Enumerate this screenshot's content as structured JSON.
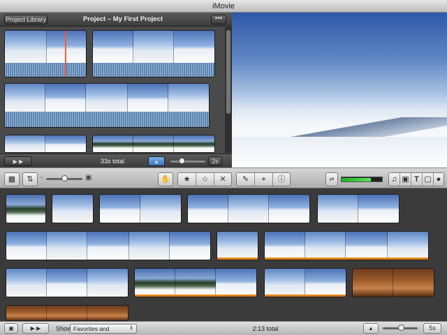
{
  "window": {
    "title": "iMovie"
  },
  "project": {
    "back_button": "Project Library",
    "title": "Project – My First Project",
    "total": "33s total",
    "zoom_value": "2s"
  },
  "toolbar": {
    "icons": [
      "camera-import-icon",
      "swap-arrows-icon",
      "hand-tool-icon",
      "star-favorite-icon",
      "star-unmark-icon",
      "reject-x-icon",
      "microphone-icon",
      "crop-icon",
      "info-icon",
      "music-icon",
      "photo-icon",
      "title-icon",
      "transition-icon",
      "globe-icon"
    ]
  },
  "event": {
    "show_label": "Show:",
    "show_value": "Favorites and Unmarked",
    "total": "2:13 total",
    "zoom_value": "5s"
  },
  "colors": {
    "audio_waveform": "#5b84b0",
    "favorite_bar": "#e0851c",
    "playhead": "#ff5a3a",
    "meter_green": "#1db31d"
  }
}
